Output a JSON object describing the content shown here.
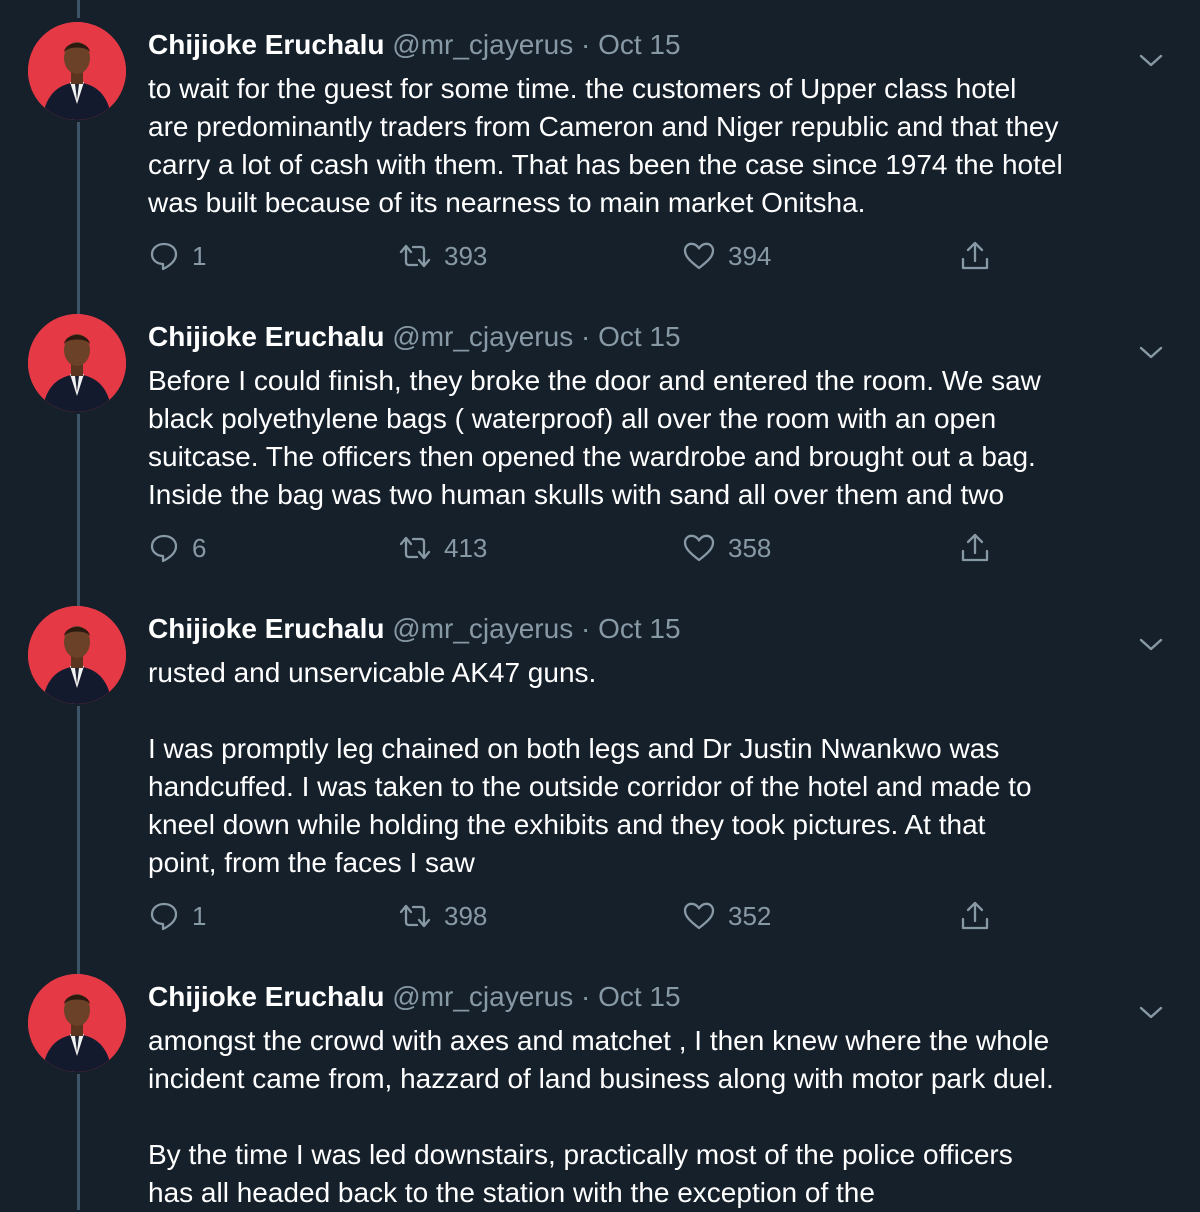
{
  "tweets": [
    {
      "author_name": "Chijioke Eruchalu",
      "handle": "@mr_cjayerus",
      "separator": "·",
      "date": "Oct 15",
      "paragraphs": [
        "to wait for the guest for some time. the customers of Upper class hotel\nare predominantly traders from Cameron and Niger republic  and that they\ncarry a lot of cash with them. That has been the case since 1974 the hotel\nwas built because of its nearness to main market Onitsha."
      ],
      "replies": "1",
      "retweets": "393",
      "likes": "394"
    },
    {
      "author_name": "Chijioke Eruchalu",
      "handle": "@mr_cjayerus",
      "separator": "·",
      "date": "Oct 15",
      "paragraphs": [
        "Before I could finish, they broke the door and entered the room. We saw\nblack polyethylene bags ( waterproof) all over the room with an open\nsuitcase. The officers then opened the wardrobe and brought out a bag.\nInside the bag was two human skulls with sand all over them and two"
      ],
      "replies": "6",
      "retweets": "413",
      "likes": "358"
    },
    {
      "author_name": "Chijioke Eruchalu",
      "handle": "@mr_cjayerus",
      "separator": "·",
      "date": "Oct 15",
      "paragraphs": [
        "rusted and unservicable AK47 guns.",
        "I was promptly leg chained on both legs and Dr Justin Nwankwo was\nhandcuffed. I was taken to the outside corridor of the hotel and made to\nkneel down while holding the exhibits and they took pictures. At that\npoint, from the faces I saw"
      ],
      "replies": "1",
      "retweets": "398",
      "likes": "352"
    },
    {
      "author_name": "Chijioke Eruchalu",
      "handle": "@mr_cjayerus",
      "separator": "·",
      "date": "Oct 15",
      "paragraphs": [
        "amongst the crowd with axes and matchet , I then knew where the whole\nincident came from, hazzard of land business along with motor park duel.",
        "By  the time I was led downstairs, practically most of the police officers\nhas all headed back to the station with the exception of the"
      ]
    }
  ],
  "icons": {
    "reply": "reply-icon",
    "retweet": "retweet-icon",
    "like": "like-icon",
    "share": "share-icon",
    "more": "chevron-down-icon"
  },
  "colors": {
    "background": "#15202b",
    "text_primary": "#ffffff",
    "text_secondary": "#8899a6",
    "thread_line": "#3d5466",
    "avatar_background": "#e63946"
  }
}
